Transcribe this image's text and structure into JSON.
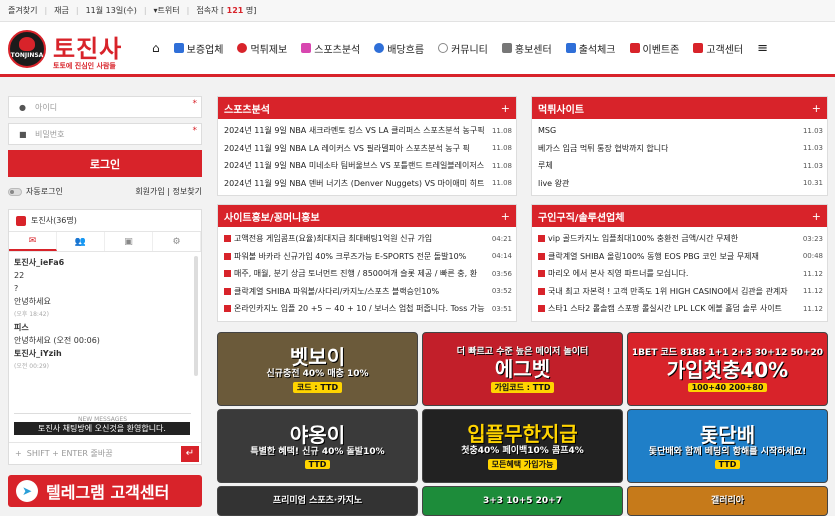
{
  "topbar": {
    "bookmark": "즐겨찾기",
    "inquiry": "재금",
    "date": "11월 13일(수)",
    "twitter": "트위터",
    "visitors_label": "접속자",
    "visitors_count": "121",
    "visitors_suffix": "명"
  },
  "logo": {
    "main": "토진사",
    "circle": "TONJINSA",
    "sub": "토토에 진심인 사람들"
  },
  "nav": [
    {
      "label": "보증업체",
      "icon": "check-icon",
      "color": "#2f6fd8"
    },
    {
      "label": "먹튀제보",
      "icon": "ban-icon",
      "color": "#d8232a"
    },
    {
      "label": "스포츠분석",
      "icon": "chart-icon",
      "color": "#d847b0"
    },
    {
      "label": "배당흐름",
      "icon": "soccer-icon",
      "color": "#2f6fd8"
    },
    {
      "label": "커뮤니티",
      "icon": "chat-icon",
      "color": "#888"
    },
    {
      "label": "홍보센터",
      "icon": "megaphone-icon",
      "color": "#555"
    },
    {
      "label": "출석체크",
      "icon": "calendar-icon",
      "color": "#2f6fd8"
    },
    {
      "label": "이벤트존",
      "icon": "gift-icon",
      "color": "#d8232a"
    },
    {
      "label": "고객센터",
      "icon": "flag-icon",
      "color": "#d8232a"
    }
  ],
  "login": {
    "id_placeholder": "아이디",
    "pw_placeholder": "비밀번호",
    "button": "로그인",
    "auto": "자동로그인",
    "join": "회원가입",
    "find": "정보찾기"
  },
  "chat": {
    "title": "토진사(36명)",
    "lines": [
      {
        "name": "토진사_ieFa6",
        "text": "22"
      },
      {
        "name": "",
        "text": "?"
      },
      {
        "name": "",
        "text": "안녕하세요"
      },
      {
        "name": "",
        "text": "(오후 18:42)"
      },
      {
        "name": "피스",
        "text": ""
      },
      {
        "name": "",
        "text": "안녕하세요  (오전 00:06)"
      },
      {
        "name": "토진사_iYzih",
        "text": ""
      },
      {
        "name": "",
        "text": "(오전 00:29)"
      }
    ],
    "new": "NEW MESSAGES",
    "welcome": "토진사 채팅방에 오신것을 환영합니다.",
    "input": "SHIFT + ENTER 줄바꿈"
  },
  "telegram": "텔레그램 고객센터",
  "boards": {
    "sports": {
      "title": "스포츠분석",
      "items": [
        {
          "t": "2024년 11월 9일 NBA 새크라멘토 킹스 VS LA 클리퍼스 스포츠분석 농구픽",
          "d": "11.08"
        },
        {
          "t": "2024년 11월 9일 NBA LA 레이커스 VS 필라델피아 스포츠분석 농구 픽",
          "d": "11.08"
        },
        {
          "t": "2024년 11월 9일 NBA 미네소타 팀버울브스 VS 포틀랜드 트레일블레이저스",
          "d": "11.08"
        },
        {
          "t": "2024년 11월 9일 NBA 덴버 너기츠 (Denver Nuggets) VS 마이애미 히트",
          "d": "11.08"
        }
      ]
    },
    "scam": {
      "title": "먹튀사이트",
      "items": [
        {
          "t": "MSG",
          "d": "11.03"
        },
        {
          "t": "베가스 입금 먹튀 통장 협박까지 합니다",
          "d": "11.03"
        },
        {
          "t": "루체",
          "d": "11.03"
        },
        {
          "t": "live 왕관",
          "d": "10.31"
        }
      ]
    },
    "promo": {
      "title": "사이트홍보/꽁머니홍보",
      "items": [
        {
          "t": "고액전용 게임콤프(요율)최대지급 최대배팅1억원 신규 가입",
          "d": "04:21"
        },
        {
          "t": "파워볼 바카라 신규가입 40% 크루즈가능 E-SPORTS 전문 돌발10%",
          "d": "04:14"
        },
        {
          "t": "매주, 매월, 분기 상금 토너먼트 진행 / 8500여개 슬롯 제공 / 빠른 충, 환",
          "d": "03:56"
        },
        {
          "t": "클락계열 SHIBA 파워볼/사다리/카지노/스포츠 블랙승인10%",
          "d": "03:52"
        },
        {
          "t": "온라인카지노 입플 20 +5 ~ 40 + 10 / 보너스 업첩 퍼줍니다. Toss 가능",
          "d": "03:51"
        }
      ]
    },
    "jobs": {
      "title": "구인구직/솔루션업체",
      "items": [
        {
          "t": "vip 골드카지노 입플최대100% 충환전 금액/시간 무제한",
          "d": "03:23"
        },
        {
          "t": "클락계열 SHIBA 올링100% 동행 EOS PBG 코인 보글 무제재",
          "d": "00:48"
        },
        {
          "t": "마리오 에서 본사 직영 파트너를 모십니다.",
          "d": "11.12"
        },
        {
          "t": "국내 최고 자본력 ! 고객 만족도 1위 HIGH CASINO에서 김관을 관계자",
          "d": "11.12"
        },
        {
          "t": "스타1 스타2 롤솔캠 스포짱 롤실시간 LPL LCK 에볼 홀덤 솔루 사이트",
          "d": "11.12"
        }
      ]
    }
  },
  "banners": [
    {
      "big": "벳보이",
      "sm": "신규충전 40% 매충 10%",
      "chip": "코드 : TTD",
      "bg": "#6b5a3a"
    },
    {
      "big": "에그벳",
      "sm": "더 빠르고 수준 높은 메이저 놀이터",
      "chip": "가입코드 : TTD",
      "bg": "#c21f2a"
    },
    {
      "big": "가입첫충40%",
      "sm": "1BET 코드 8188  1+1 2+3 30+12 50+20",
      "chip": "100+40 200+80",
      "bg": "#d8232a"
    },
    {
      "big": "야옹이",
      "sm": "특별한 혜택! 신규 40% 돌발10%",
      "chip": "TTD",
      "bg": "#3a3a3a"
    },
    {
      "big": "입플무한지급",
      "sm": "첫충40% 페이백10% 콤프4%",
      "chip": "모든혜택 가입가능",
      "bg": "#222"
    },
    {
      "big": "돛단배",
      "sm": "돛단배와 함께 베팅의 항해를 시작하세요!",
      "chip": "TTD",
      "bg": "#1f7fc8"
    }
  ],
  "bottom_banners": [
    {
      "sm": "프리미엄 스포츠·카지노",
      "bg": "#333"
    },
    {
      "sm": "3+3 10+5 20+7",
      "bg": "#1d8c3a"
    },
    {
      "sm": "갤러리아",
      "bg": "#c67a1a"
    }
  ]
}
